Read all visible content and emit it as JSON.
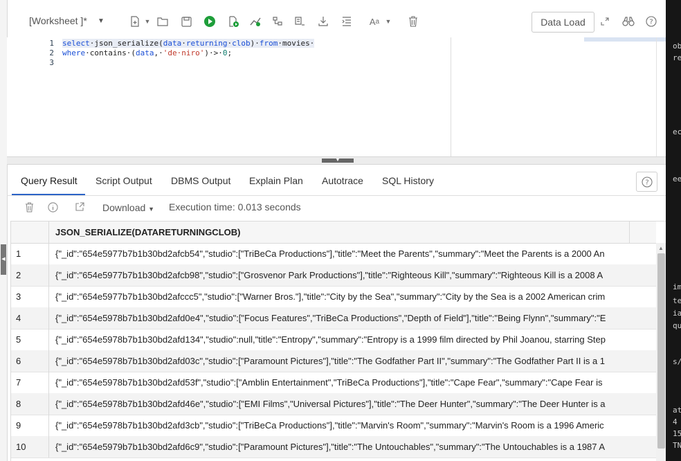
{
  "toolbar": {
    "worksheet_tab": "[Worksheet ]*",
    "data_load_label": "Data Load"
  },
  "editor": {
    "line_numbers": [
      "1",
      "2",
      "3"
    ]
  },
  "tabs": {
    "query_result": "Query Result",
    "script_output": "Script Output",
    "dbms_output": "DBMS Output",
    "explain_plan": "Explain Plan",
    "autotrace": "Autotrace",
    "sql_history": "SQL History"
  },
  "results": {
    "download_label": "Download",
    "execution_time": "Execution time: 0.013 seconds",
    "column_header": "JSON_SERIALIZE(DATARETURNINGCLOB)",
    "rows": [
      {
        "num": "1",
        "value": "{\"_id\":\"654e5977b7b1b30bd2afcb54\",\"studio\":[\"TriBeCa Productions\"],\"title\":\"Meet the Parents\",\"summary\":\"Meet the Parents is a 2000 An"
      },
      {
        "num": "2",
        "value": "{\"_id\":\"654e5977b7b1b30bd2afcb98\",\"studio\":[\"Grosvenor Park Productions\"],\"title\":\"Righteous Kill\",\"summary\":\"Righteous Kill is a 2008 A"
      },
      {
        "num": "3",
        "value": "{\"_id\":\"654e5977b7b1b30bd2afccc5\",\"studio\":[\"Warner Bros.\"],\"title\":\"City by the Sea\",\"summary\":\"City by the Sea is a 2002 American crim"
      },
      {
        "num": "4",
        "value": "{\"_id\":\"654e5978b7b1b30bd2afd0e4\",\"studio\":[\"Focus Features\",\"TriBeCa Productions\",\"Depth of Field\"],\"title\":\"Being Flynn\",\"summary\":\"E"
      },
      {
        "num": "5",
        "value": "{\"_id\":\"654e5978b7b1b30bd2afd134\",\"studio\":null,\"title\":\"Entropy\",\"summary\":\"Entropy is a 1999 film directed by Phil Joanou, starring Step"
      },
      {
        "num": "6",
        "value": "{\"_id\":\"654e5978b7b1b30bd2afd03c\",\"studio\":[\"Paramount Pictures\"],\"title\":\"The Godfather Part II\",\"summary\":\"The Godfather Part II is a 1"
      },
      {
        "num": "7",
        "value": "{\"_id\":\"654e5978b7b1b30bd2afd53f\",\"studio\":[\"Amblin Entertainment\",\"TriBeCa Productions\"],\"title\":\"Cape Fear\",\"summary\":\"Cape Fear is"
      },
      {
        "num": "8",
        "value": "{\"_id\":\"654e5978b7b1b30bd2afd46e\",\"studio\":[\"EMI Films\",\"Universal Pictures\"],\"title\":\"The Deer Hunter\",\"summary\":\"The Deer Hunter is a"
      },
      {
        "num": "9",
        "value": "{\"_id\":\"654e5978b7b1b30bd2afd3cb\",\"studio\":[\"TriBeCa Productions\"],\"title\":\"Marvin's Room\",\"summary\":\"Marvin's Room is a 1996 Americ"
      },
      {
        "num": "10",
        "value": "{\"_id\":\"654e5979b7b1b30bd2afd6c9\",\"studio\":[\"Paramount Pictures\"],\"title\":\"The Untouchables\",\"summary\":\"The Untouchables is a 1987 A"
      }
    ]
  },
  "terminal": {
    "lines": [
      "ob",
      "re",
      "ec",
      "ee",
      "im",
      "te",
      "ia",
      "qu",
      "s/",
      "at",
      "4",
      "15",
      "TN"
    ]
  },
  "colors": {
    "accent": "#2b63c7",
    "run_green": "#1e9e3a",
    "keyword_blue": "#1a4fd6",
    "string_red": "#c0392b"
  }
}
